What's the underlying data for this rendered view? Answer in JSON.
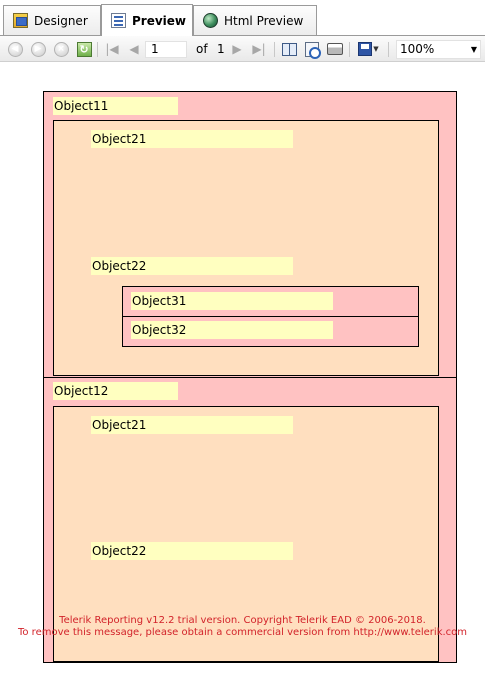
{
  "tabs": [
    {
      "label": "Designer",
      "icon": "designer-icon",
      "active": false
    },
    {
      "label": "Preview",
      "icon": "preview-icon",
      "active": true
    },
    {
      "label": "Html Preview",
      "icon": "html-preview-icon",
      "active": false
    }
  ],
  "toolbar": {
    "current_page": "1",
    "of_label": "of",
    "total_pages": "1",
    "zoom": "100%"
  },
  "report": {
    "groups": [
      {
        "label": "Object11",
        "subsections": [
          {
            "label": "Object21"
          },
          {
            "label": "Object22",
            "inner": [
              "Object31",
              "Object32"
            ]
          }
        ]
      },
      {
        "label": "Object12",
        "subsections": [
          {
            "label": "Object21"
          },
          {
            "label": "Object22"
          }
        ]
      }
    ]
  },
  "watermark": {
    "line1": "Telerik Reporting v12.2 trial version. Copyright Telerik EAD © 2006-2018.",
    "line2": "To remove this message, please obtain a commercial version from http://www.telerik.com"
  },
  "colors": {
    "group_background": "#ffc2c2",
    "subsection_background": "#ffdfbf",
    "label_background": "#ffffc0",
    "watermark_text": "#d2232a"
  }
}
